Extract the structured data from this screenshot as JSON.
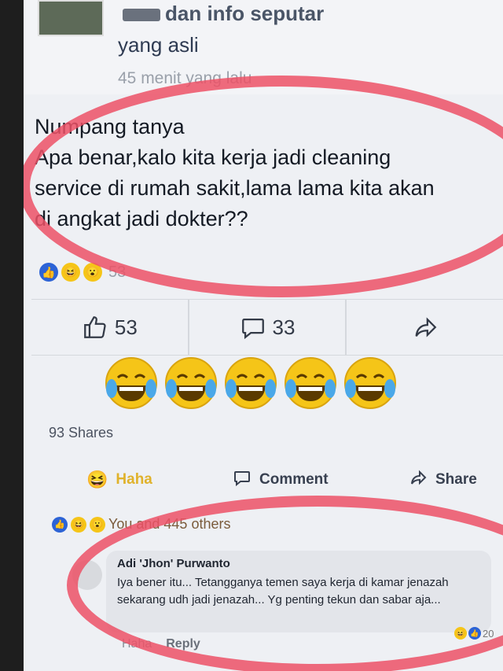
{
  "header": {
    "line1": "dan info seputar",
    "line2": "yang asli",
    "timestamp": "45 menit yang lalu"
  },
  "post": {
    "text": "Numpang tanya\nApa benar,kalo kita kerja jadi cleaning\nservice di rumah sakit,lama lama kita akan\ndi angkat jadi dokter??"
  },
  "reactions": {
    "count": "53",
    "like_icon": "thumbs-up-icon",
    "haha_icon": "laugh-emoji-icon",
    "wow_icon": "wow-emoji-icon"
  },
  "actionbar": {
    "likes": "53",
    "comments": "33",
    "share_icon": "share-arrow-icon"
  },
  "laugh_emojis_count": 5,
  "shares": "93 Shares",
  "bottom_actions": {
    "haha": "Haha",
    "comment": "Comment",
    "share": "Share"
  },
  "social_summary": "You and 445 others",
  "comment": {
    "author": "Adi 'Jhon' Purwanto",
    "text": "Iya bener itu... Tetangganya temen saya kerja di kamar jenazah sekarang udh jadi jenazah... Yg penting tekun dan sabar aja...",
    "haha": "Haha",
    "reply": "Reply",
    "react_count": "20"
  },
  "colors": {
    "annotation_circle": "#ec5166",
    "like_blue": "#2c63d6",
    "emoji_yellow": "#f5c518"
  }
}
